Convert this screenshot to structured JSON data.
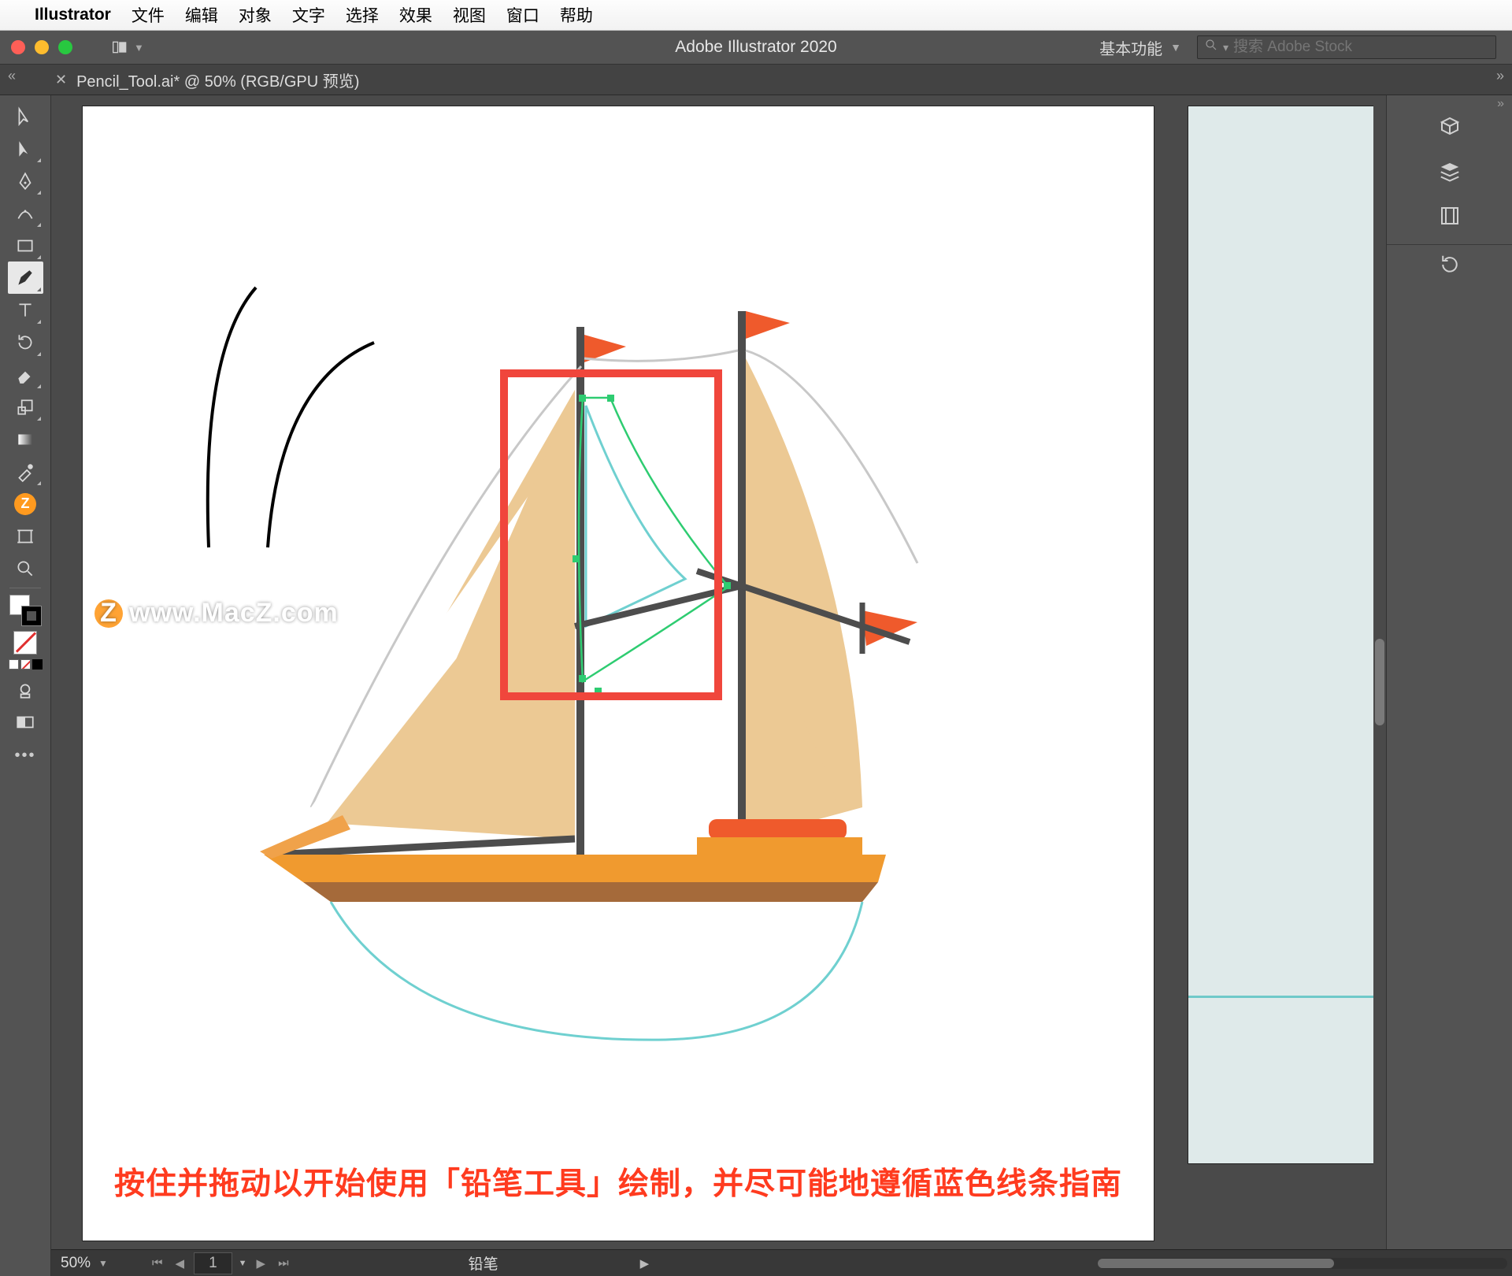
{
  "menubar": {
    "app_name": "Illustrator",
    "items": [
      "文件",
      "编辑",
      "对象",
      "文字",
      "选择",
      "效果",
      "视图",
      "窗口",
      "帮助"
    ]
  },
  "window": {
    "title": "Adobe Illustrator 2020",
    "workspace_label": "基本功能",
    "search_placeholder": "搜索 Adobe Stock"
  },
  "tab": {
    "label": "Pencil_Tool.ai* @ 50% (RGB/GPU 预览)"
  },
  "tools": [
    {
      "name": "selection-tool",
      "corner": false
    },
    {
      "name": "direct-selection-tool",
      "corner": true
    },
    {
      "name": "pen-tool",
      "corner": true
    },
    {
      "name": "curvature-tool",
      "corner": true
    },
    {
      "name": "rectangle-tool",
      "corner": true
    },
    {
      "name": "pencil-tool",
      "corner": true,
      "active": true
    },
    {
      "name": "type-tool",
      "corner": true
    },
    {
      "name": "rotate-tool",
      "corner": true
    },
    {
      "name": "eraser-tool",
      "corner": true
    },
    {
      "name": "scale-tool",
      "corner": true
    },
    {
      "name": "gradient-tool",
      "corner": false
    },
    {
      "name": "eyedropper-tool",
      "corner": true
    },
    {
      "name": "macz-badge",
      "corner": false
    },
    {
      "name": "artboard-tool",
      "corner": false
    },
    {
      "name": "zoom-tool",
      "corner": false
    }
  ],
  "right_panels": {
    "group1": [
      "3d-icon",
      "layers-icon",
      "libraries-icon"
    ],
    "group2": [
      "appearance-refresh-icon"
    ]
  },
  "statusbar": {
    "zoom": "50%",
    "page": "1",
    "tool_name": "铅笔"
  },
  "instruction_text": "按住并拖动以开始使用「铅笔工具」绘制，并尽可能地遵循蓝色线条指南",
  "watermark": "www.MacZ.com",
  "colors": {
    "accent_red": "#f0463c",
    "sail": "#ecc994",
    "flag": "#ef5a2c",
    "deck_light": "#f09a2f",
    "deck_dark": "#a56a3a",
    "cabin": "#ef5a2c",
    "mast": "#4d4d4d",
    "guide": "#6fd0d0",
    "path_green": "#2ecc71"
  }
}
